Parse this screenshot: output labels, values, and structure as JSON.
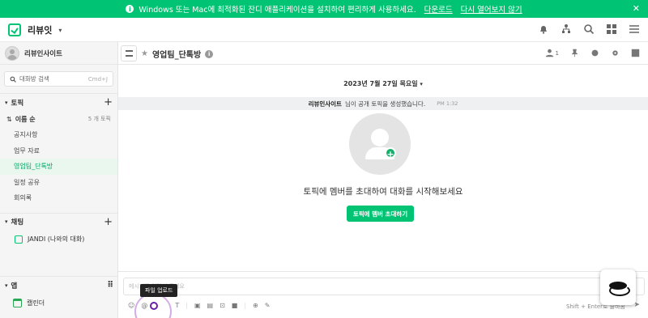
{
  "banner": {
    "text": "Windows 또는 Mac에 최적화된 잔디 애플리케이션을 설치하여 편리하게 사용하세요.",
    "download": "다운로드",
    "dismiss": "다시 열어보지 않기",
    "color": "#00c473"
  },
  "app": {
    "name": "리뷰잇"
  },
  "sidebar": {
    "profile_name": "리뷰인사이트",
    "search_placeholder": "대화방 검색",
    "search_shortcut": "Cmd+J",
    "topics_label": "토픽",
    "sort_label": "이름 순",
    "topic_count": "5 개 토픽",
    "topics": [
      "공지사항",
      "업무 자료",
      "영업팀_단톡방",
      "일정 공유",
      "회의록"
    ],
    "active_topic": "영업팀_단톡방",
    "chat_label": "채팅",
    "chats": [
      "JANDI (나와의 대화)"
    ],
    "apps_label": "앱",
    "apps": [
      "캘린더"
    ]
  },
  "main": {
    "title": "영업팀_단톡방",
    "member_count": "1",
    "date": "2023년 7월 27일 목요일",
    "system_actor": "리뷰인사이트",
    "system_message": "님이 공개 토픽을 생성했습니다.",
    "system_time": "PM 1:32",
    "empty_text": "토픽에 멤버를 초대하여 대화를 시작해보세요",
    "invite_button": "토픽에 멤버 초대하기"
  },
  "composer": {
    "placeholder": "메시지를 입력해 주세요",
    "tooltip": "파일 업로드",
    "send_hint": "Shift + Enter로 줄바꿈"
  }
}
